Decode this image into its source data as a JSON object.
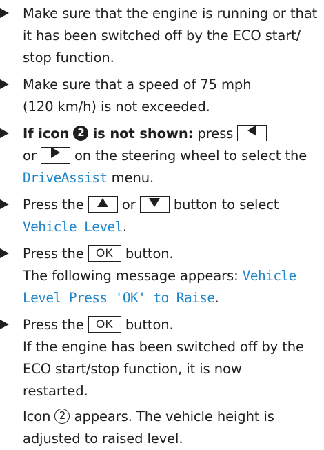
{
  "steps": [
    {
      "lines": [
        "Make sure that the engine is running or that",
        "it has been switched off by the ECO start/",
        "stop function."
      ]
    },
    {
      "lines": [
        "Make sure that a speed of 75 mph",
        "(120 km/h) is not exceeded."
      ]
    },
    {
      "bold_prefix": "If icon",
      "icon_number": "2",
      "bold_suffix": "is not shown:",
      "press": "press",
      "or": "or",
      "line2_rest": "on the steering wheel to select the",
      "menu": "DriveAssist",
      "menu_suffix": "menu."
    },
    {
      "press_the": "Press the",
      "or": "or",
      "rest": "button to select",
      "menu_item": "Vehicle Level",
      "dot": "."
    },
    {
      "press_the": "Press the",
      "key": "OK",
      "button": "button.",
      "message_intro": "The following message appears:",
      "message_part1": "Vehicle",
      "message_part2": "Level Press 'OK' to Raise",
      "dot": "."
    },
    {
      "press_the": "Press the",
      "key": "OK",
      "button": "button.",
      "lines": [
        "If the engine has been switched off by the",
        "ECO start/stop function, it is now",
        "restarted."
      ],
      "icon_prefix": "Icon",
      "icon_number": "2",
      "icon_suffix": "appears. The vehicle height is",
      "last_line": "adjusted to raised level."
    }
  ],
  "colors": {
    "text": "#1f1f1f",
    "display_text": "#1f86c9"
  },
  "icons": {
    "bullet": "right-triangle-bullet",
    "arrow_left": "left-arrow-key",
    "arrow_right": "right-arrow-key",
    "arrow_up": "up-arrow-key",
    "arrow_down": "down-arrow-key"
  }
}
